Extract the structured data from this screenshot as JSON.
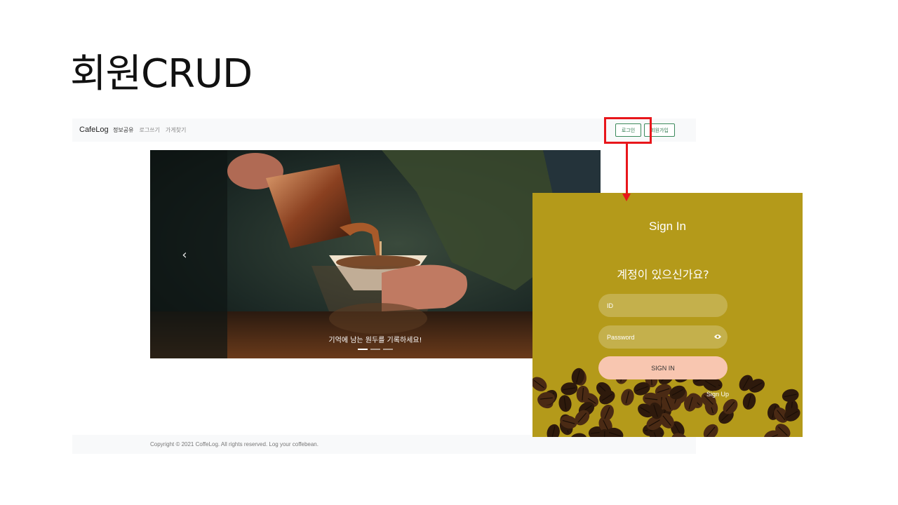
{
  "slide": {
    "title": "회원CRUD"
  },
  "nav": {
    "brand": "CafeLog",
    "links": [
      {
        "label": "정보공유",
        "active": true
      },
      {
        "label": "로그쓰기",
        "active": false
      },
      {
        "label": "가게찾기",
        "active": false
      }
    ],
    "login_label": "로그인",
    "signup_label": "회원가입"
  },
  "carousel": {
    "caption": "기억에 남는 원두를 기록하세요!",
    "prev_glyph": "‹",
    "slide_count": 3,
    "active_index": 0
  },
  "footer": {
    "copyright": "Copyright © 2021 CoffeLog. All rights reserved. Log your coffebean."
  },
  "login_panel": {
    "title": "Sign In",
    "question": "계정이 있으신가요?",
    "id_placeholder": "ID",
    "password_placeholder": "Password",
    "signin_label": "SIGN IN",
    "signup_link": "Sign Up"
  },
  "colors": {
    "highlight": "#e8161b",
    "panel_bg": "#b49a1a",
    "signin_button": "#f8c6b0",
    "nav_button_border": "#3b8a5c"
  }
}
